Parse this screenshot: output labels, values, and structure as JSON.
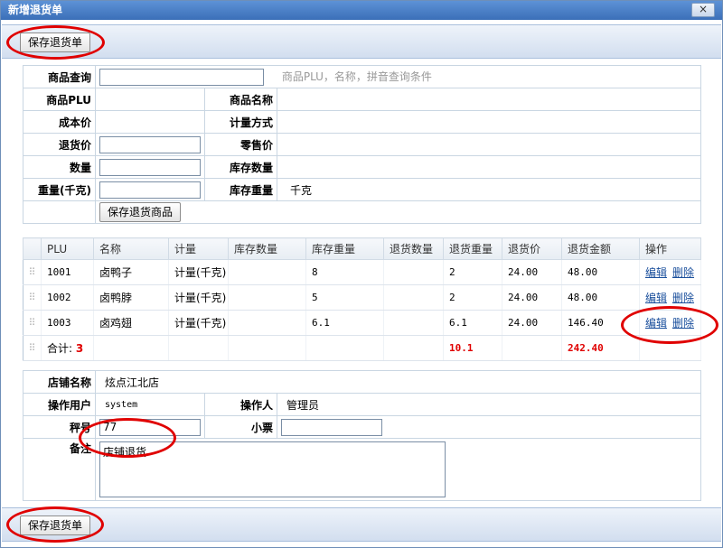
{
  "window": {
    "title": "新增退货单",
    "close_label": "×"
  },
  "toolbar": {
    "save_label": "保存退货单"
  },
  "product_form": {
    "query_label": "商品查询",
    "query_value": "",
    "query_hint": "商品PLU，名称，拼音查询条件",
    "plu_label": "商品PLU",
    "name_label": "商品名称",
    "cost_label": "成本价",
    "measure_label": "计量方式",
    "return_price_label": "退货价",
    "retail_price_label": "零售价",
    "qty_label": "数量",
    "stock_qty_label": "库存数量",
    "weight_label": "重量(千克)",
    "stock_weight_label": "库存重量",
    "stock_weight_unit": "千克",
    "save_item_label": "保存退货商品"
  },
  "grid": {
    "columns": [
      "PLU",
      "名称",
      "计量",
      "库存数量",
      "库存重量",
      "退货数量",
      "退货重量",
      "退货价",
      "退货金额",
      "操作"
    ],
    "rows": [
      {
        "plu": "1001",
        "name": "卤鸭子",
        "measure": "计量(千克)",
        "stock_qty": "",
        "stock_weight": "8",
        "return_qty": "",
        "return_weight": "2",
        "price": "24.00",
        "amount": "48.00"
      },
      {
        "plu": "1002",
        "name": "卤鸭脖",
        "measure": "计量(千克)",
        "stock_qty": "",
        "stock_weight": "5",
        "return_qty": "",
        "return_weight": "2",
        "price": "24.00",
        "amount": "48.00"
      },
      {
        "plu": "1003",
        "name": "卤鸡翅",
        "measure": "计量(千克)",
        "stock_qty": "",
        "stock_weight": "6.1",
        "return_qty": "",
        "return_weight": "6.1",
        "price": "24.00",
        "amount": "146.40"
      }
    ],
    "edit_label": "编辑",
    "delete_label": "删除",
    "total_label": "合计:",
    "total_count": "3",
    "total_weight": "10.1",
    "total_amount": "242.40"
  },
  "store_form": {
    "store_label": "店铺名称",
    "store_value": "炫点江北店",
    "user_label": "操作用户",
    "user_value": "system",
    "operator_label": "操作人",
    "operator_value": "管理员",
    "scale_label": "秤号",
    "scale_value": "77",
    "receipt_label": "小票",
    "receipt_value": "",
    "note_label": "备注",
    "note_value": "店铺退货"
  },
  "colors": {
    "accent": "#3b6fb8",
    "highlight": "#e00000",
    "link": "#1a4f9c"
  }
}
